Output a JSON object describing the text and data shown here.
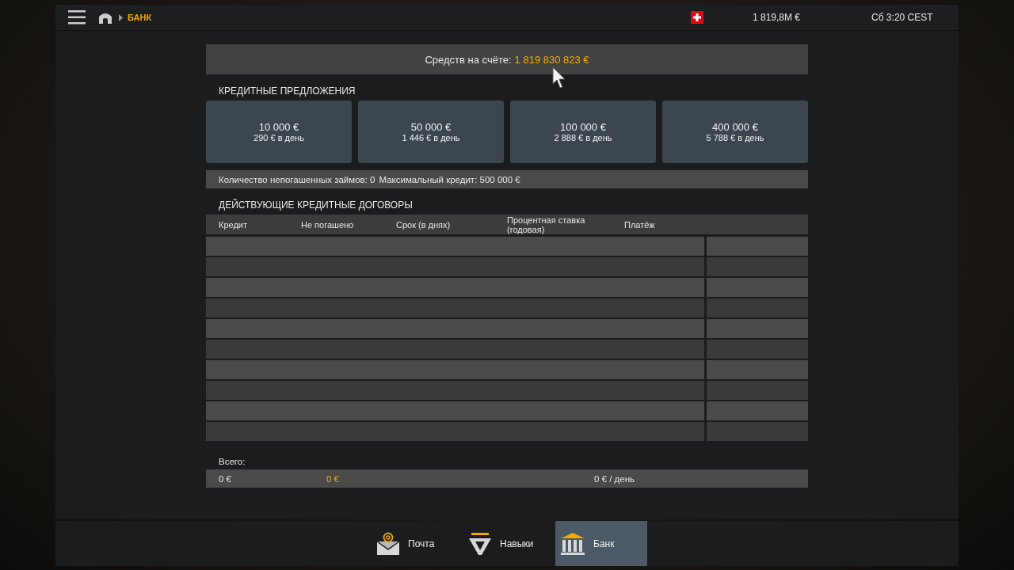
{
  "top_bar": {
    "breadcrumb": "БАНК",
    "money": "1 819,8M  €",
    "clock": "Сб 3:20 CEST"
  },
  "balance": {
    "label": "Средств на счёте:",
    "amount": "1 819 830 823 €"
  },
  "offers": {
    "title": "КРЕДИТНЫЕ ПРЕДЛОЖЕНИЯ",
    "items": [
      {
        "amount": "10 000 €",
        "daily": "290 € в день"
      },
      {
        "amount": "50 000 €",
        "daily": "1 446 € в день"
      },
      {
        "amount": "100 000 €",
        "daily": "2 888 € в день"
      },
      {
        "amount": "400 000 €",
        "daily": "5 788 € в день"
      }
    ]
  },
  "info": [
    "Количество непогашенных займов: 0",
    "Максимальный кредит: 500 000 €"
  ],
  "contracts": {
    "title": "ДЕЙСТВУЮЩИЕ КРЕДИТНЫЕ ДОГОВОРЫ",
    "columns": [
      "Кредит",
      "Не погашено",
      "Срок (в днях)",
      "Процентная ставка (годовая)",
      "Платёж"
    ]
  },
  "totals": {
    "label": "Всего:",
    "values": [
      {
        "text": "0 €",
        "highlight": false
      },
      {
        "text": "0 €",
        "highlight": true
      },
      {
        "text": "0 € / день",
        "highlight": false
      }
    ]
  },
  "tabs": [
    {
      "label": "Почта",
      "kind": "mail",
      "selected": false
    },
    {
      "label": "Навыки",
      "kind": "skills",
      "selected": false
    },
    {
      "label": "Банк",
      "kind": "bank",
      "selected": true
    }
  ]
}
